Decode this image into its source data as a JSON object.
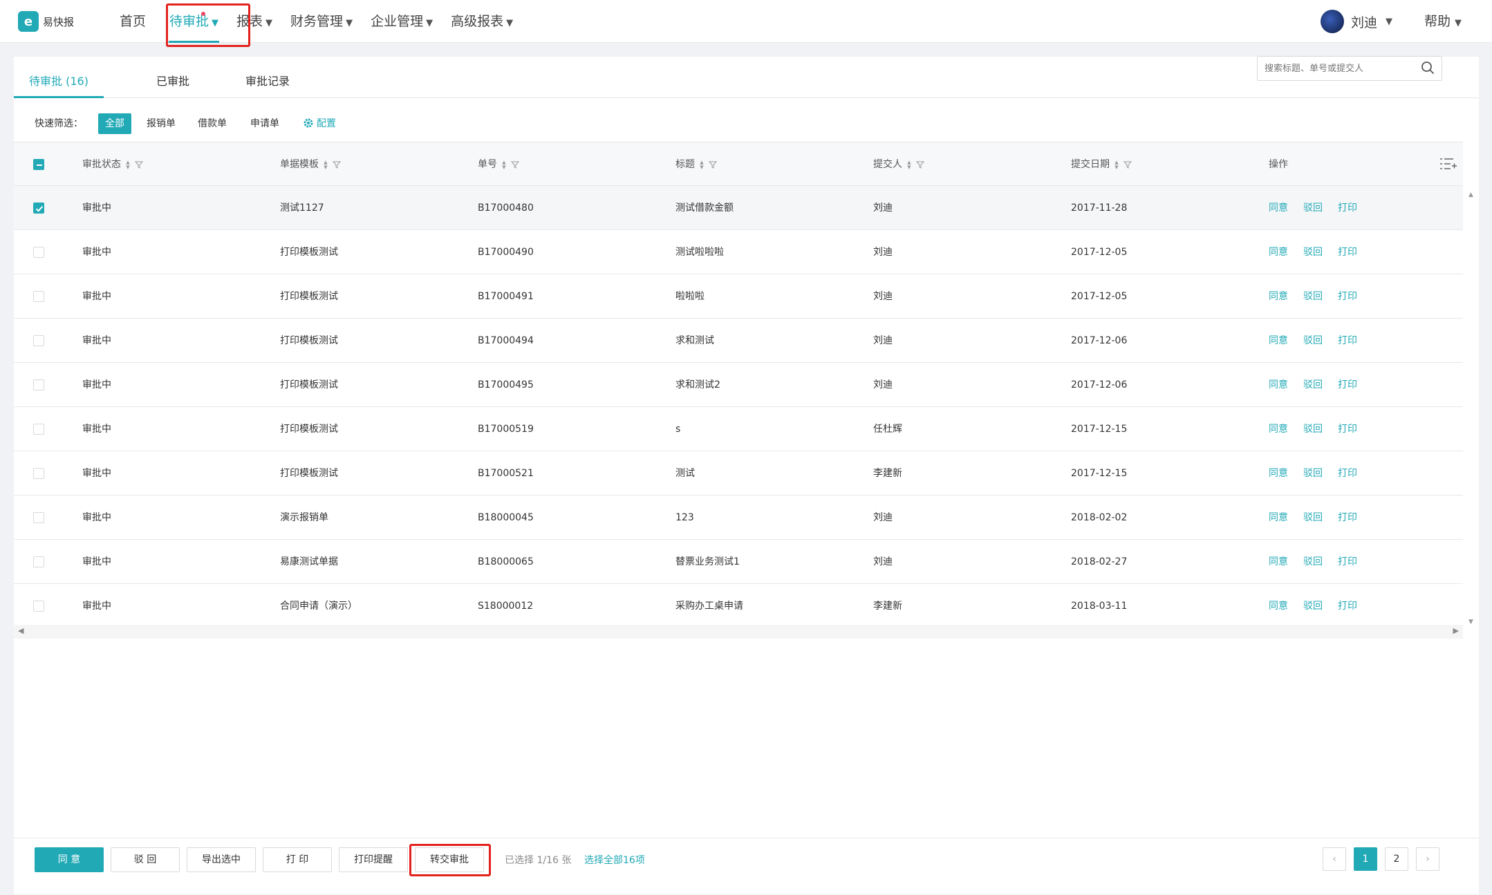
{
  "app": {
    "logo_text": "易快报",
    "logo_glyph": "e"
  },
  "nav": {
    "items": [
      {
        "label": "首页",
        "has_caret": false
      },
      {
        "label": "待审批",
        "has_caret": true,
        "active": true
      },
      {
        "label": "报表",
        "has_caret": true
      },
      {
        "label": "财务管理",
        "has_caret": true
      },
      {
        "label": "企业管理",
        "has_caret": true
      },
      {
        "label": "高级报表",
        "has_caret": true
      }
    ],
    "user": "刘迪",
    "help": "帮助"
  },
  "tabs": [
    {
      "label": "待审批 (16)",
      "active": true
    },
    {
      "label": "已审批"
    },
    {
      "label": "审批记录"
    }
  ],
  "filter": {
    "label": "快速筛选：",
    "chips": [
      {
        "label": "全部",
        "active": true
      },
      {
        "label": "报销单"
      },
      {
        "label": "借款单"
      },
      {
        "label": "申请单"
      }
    ],
    "config_label": "配置",
    "search_placeholder": "搜索标题、单号或提交人"
  },
  "table": {
    "columns": [
      "审批状态",
      "单据模板",
      "单号",
      "标题",
      "提交人",
      "提交日期",
      "操作"
    ],
    "rows": [
      {
        "checked": true,
        "status": "审批中",
        "template": "测试1127",
        "code": "B17000480",
        "title": "测试借款金额",
        "submitter": "刘迪",
        "date": "2017-11-28"
      },
      {
        "checked": false,
        "status": "审批中",
        "template": "打印模板测试",
        "code": "B17000490",
        "title": "测试啦啦啦",
        "submitter": "刘迪",
        "date": "2017-12-05"
      },
      {
        "checked": false,
        "status": "审批中",
        "template": "打印模板测试",
        "code": "B17000491",
        "title": "啦啦啦",
        "submitter": "刘迪",
        "date": "2017-12-05"
      },
      {
        "checked": false,
        "status": "审批中",
        "template": "打印模板测试",
        "code": "B17000494",
        "title": "求和测试",
        "submitter": "刘迪",
        "date": "2017-12-06"
      },
      {
        "checked": false,
        "status": "审批中",
        "template": "打印模板测试",
        "code": "B17000495",
        "title": "求和测试2",
        "submitter": "刘迪",
        "date": "2017-12-06"
      },
      {
        "checked": false,
        "status": "审批中",
        "template": "打印模板测试",
        "code": "B17000519",
        "title": "s",
        "submitter": "任杜辉",
        "date": "2017-12-15"
      },
      {
        "checked": false,
        "status": "审批中",
        "template": "打印模板测试",
        "code": "B17000521",
        "title": "测试",
        "submitter": "李建新",
        "date": "2017-12-15"
      },
      {
        "checked": false,
        "status": "审批中",
        "template": "演示报销单",
        "code": "B18000045",
        "title": "123",
        "submitter": "刘迪",
        "date": "2018-02-02"
      },
      {
        "checked": false,
        "status": "审批中",
        "template": "易康测试单据",
        "code": "B18000065",
        "title": "替票业务测试1",
        "submitter": "刘迪",
        "date": "2018-02-27"
      },
      {
        "checked": false,
        "status": "审批中",
        "template": "合同申请（演示）",
        "code": "S18000012",
        "title": "采购办工桌申请",
        "submitter": "李建新",
        "date": "2018-03-11"
      }
    ],
    "actions": [
      "同意",
      "驳回",
      "打印"
    ]
  },
  "footer": {
    "buttons": [
      "同 意",
      "驳 回",
      "导出选中",
      "打 印",
      "打印提醒",
      "转交审批"
    ],
    "selected_info": "已选择 1/16 张",
    "select_all": "选择全部16项",
    "pages": [
      "1",
      "2"
    ],
    "current_page": "1"
  },
  "colors": {
    "accent": "#21a9b6",
    "highlight_box": "#e3211c",
    "notify_dot": "#f04864"
  }
}
